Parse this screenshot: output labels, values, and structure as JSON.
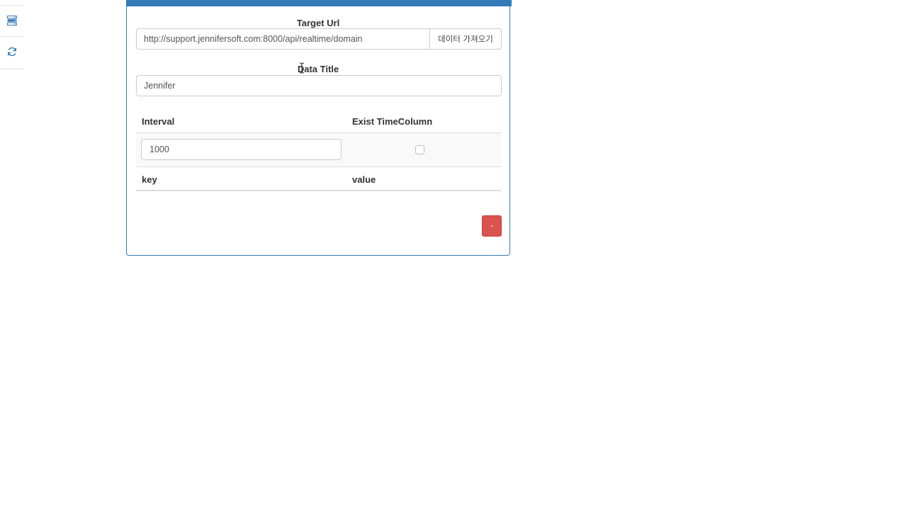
{
  "sidebar": {
    "items": [
      {
        "icon": "server-stack-icon"
      },
      {
        "icon": "refresh-icon"
      }
    ]
  },
  "colors": {
    "primary": "#337ab7",
    "danger": "#d9534f",
    "border": "#cccccc",
    "row_stripe": "#f9f9f9"
  },
  "form": {
    "target_url_label": "Target Url",
    "target_url_value": "http://support.jennifersoft.com:8000/api/realtime/domain",
    "fetch_button_label": "데이터 가져오기",
    "data_title_label": "Data Title",
    "data_title_value": "Jennifer"
  },
  "table": {
    "headers": {
      "interval": "Interval",
      "exist_time_column": "Exist TimeColumn"
    },
    "row": {
      "interval_value": "1000",
      "exist_time_column_checked": false
    },
    "kv_headers": {
      "key": "key",
      "value": "value"
    }
  },
  "remove_button_label": "-"
}
